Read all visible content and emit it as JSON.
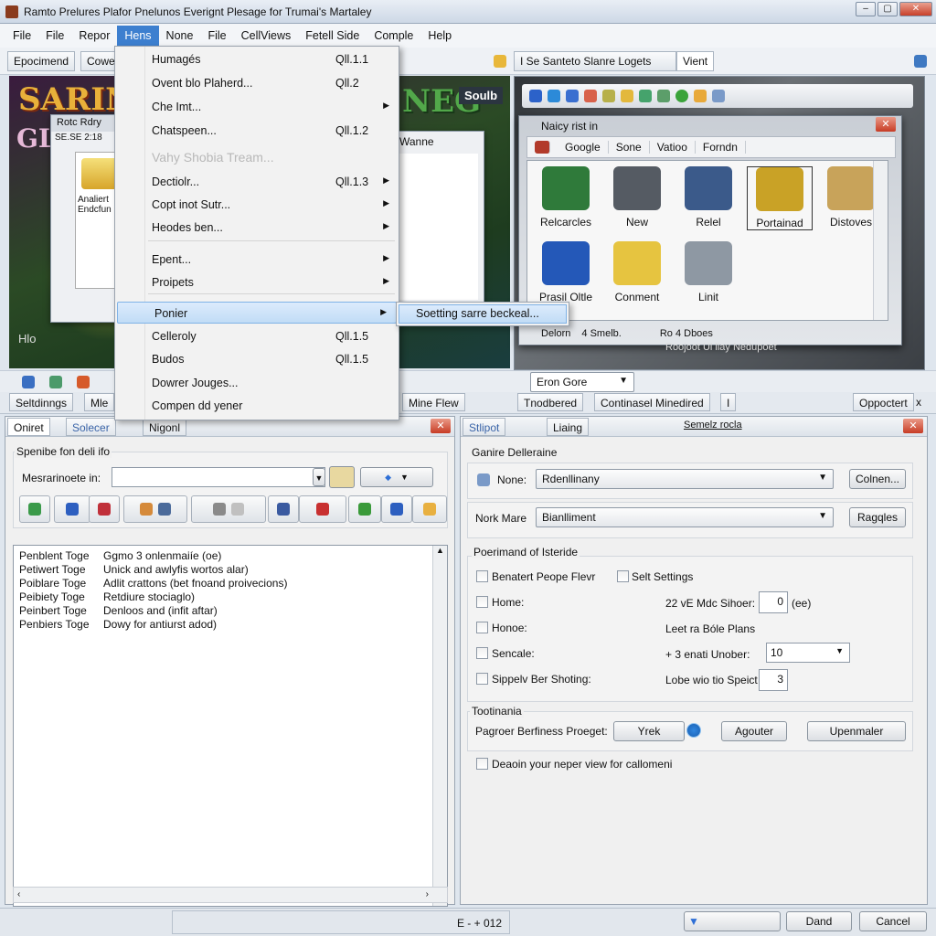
{
  "window": {
    "title": "Ramto Prelures Plafor Pnelunos Everignt Plesage for Trumai's Martaley",
    "controls": [
      "–",
      "▢",
      "✕"
    ]
  },
  "menubar": [
    "File",
    "File",
    "Repor",
    "Hens",
    "None",
    "File",
    "CellViews",
    "Fetell Side",
    "Comple",
    "Help"
  ],
  "menubar_active": 3,
  "toolbar": {
    "tab1": "Epocimend",
    "tab2": "Cowe",
    "right_tab": "I Se Santeto Slanre Logets",
    "right_tab2": "Vient"
  },
  "game": {
    "title": "SARINX",
    "title2": "GLI",
    "logo": "NEG",
    "badge": "Soulb",
    "inner_window_title": "Rotc Rdry",
    "inner_toolbar": "SE.SE 2:18",
    "inner_text1": "Analiert",
    "inner_text2": "Endcfun",
    "side_window_title": "Wanne",
    "corner_text": "Hlo"
  },
  "dropdown_menu": {
    "items": [
      {
        "label": "Humagés",
        "shortcut": "Qll.1.1",
        "arrow": false
      },
      {
        "label": "Ovent blo Plaherd...",
        "shortcut": "Qll.2",
        "arrow": false
      },
      {
        "label": "Che Imt...",
        "shortcut": "",
        "arrow": true
      },
      {
        "label": "Chatspeen...",
        "shortcut": "Qll.1.2",
        "arrow": false
      },
      {
        "label": "Vahy Shobia Tream...",
        "shortcut": "",
        "arrow": false,
        "disabled": true
      },
      {
        "label": "Dectiolr...",
        "shortcut": "Qll.1.3",
        "arrow": true
      },
      {
        "label": "Copt inot Sutr...",
        "shortcut": "",
        "arrow": true
      },
      {
        "label": "Heodes ben...",
        "shortcut": "",
        "arrow": true
      },
      {
        "label": "Epent...",
        "shortcut": "",
        "arrow": true
      },
      {
        "label": "Proipets",
        "shortcut": "",
        "arrow": true
      },
      {
        "label": "Ponier",
        "shortcut": "",
        "arrow": true,
        "highlighted": true
      },
      {
        "label": "Celleroly",
        "shortcut": "Qll.1.5",
        "arrow": false
      },
      {
        "label": "Budos",
        "shortcut": "Qll.1.5",
        "arrow": false
      },
      {
        "label": "Dowrer Jouges...",
        "shortcut": "",
        "arrow": false
      },
      {
        "label": "Compen dd yener",
        "shortcut": "",
        "arrow": false
      }
    ],
    "submenu": "Soetting sarre beckeal..."
  },
  "right_dialog": {
    "title": "Naicy rist in",
    "tabs": [
      "Google",
      "Sone",
      "Vatioo",
      "Forndn"
    ],
    "tiles": [
      {
        "label": "Relcarcles",
        "color": "#2f7a3a"
      },
      {
        "label": "New",
        "color": "#555b63"
      },
      {
        "label": "Relel",
        "color": "#3b5a8a"
      },
      {
        "label": "Portainad",
        "color": "#c9a226",
        "selected": true
      },
      {
        "label": "Distoves",
        "color": "#c8a35a"
      },
      {
        "label": "Prasil Oltle",
        "color": "#2458b8"
      },
      {
        "label": "Conment",
        "color": "#e6c440"
      },
      {
        "label": "Linit",
        "color": "#8e98a3"
      }
    ],
    "status_left": "Delorn",
    "status_mid": "4 Smelb.",
    "status_right": "Ro 4 Dboes",
    "caption": "Roojoot Ul liay Nedupoet"
  },
  "row2": {
    "combo": "Eron Gore"
  },
  "row3": {
    "left_tabs": [
      "Seltdinngs",
      "Mle",
      "Mine Flew"
    ],
    "right_tabs": [
      "Tnodbered",
      "Continasel Minedired",
      "I"
    ],
    "right_button": "Oppoctert",
    "close": "x"
  },
  "left_panel": {
    "tabs": [
      "Oniret",
      "Solecer",
      "Nigonl"
    ],
    "group_label": "Spenibe fon deli ifo",
    "field_label": "Mesrarinoete in:",
    "field_value": "",
    "list": [
      [
        "Penblent Toge",
        "Ggmo 3 onlenmaiíe (oe)"
      ],
      [
        "Petiwert Toge",
        "Unick and awlyfis wortos alar)"
      ],
      [
        "Poiblare Toge",
        "Adlit crattons (bet fnoand proivecions)"
      ],
      [
        "Peibiety Toge",
        "Retdiure stociaglo)"
      ],
      [
        "Peinbert Toge",
        "Denloos and (infit aftar)"
      ],
      [
        "Penbiers Toge",
        "Dowy for antiurst adod)"
      ]
    ]
  },
  "right_panel": {
    "tabs": [
      "Stlipot",
      "Liaing"
    ],
    "title": "Semelz rocla",
    "group1": "Ganire Delleraine",
    "none_label": "None:",
    "none_value": "Rdenllinany",
    "none_btn": "Colnen...",
    "nork_label": "Nork Mare",
    "nork_value": "Bianlliment",
    "nork_btn": "Ragqles",
    "group2": "Poerimand of Isteride",
    "checks_left": [
      "Benatert Peope Flevr",
      "Home:",
      "Honoe:",
      "Sencale:",
      "Sippelv Ber Shoting:"
    ],
    "check_mid": "Selt Settings",
    "field1_label": "22 vE Mdc Sihoer:",
    "field1_value": "0",
    "field1_unit": "(ee)",
    "text_mid": "Leet ra Bóle Plans",
    "field2_label": "+ 3 enati Unober:",
    "field2_value": "10",
    "field3_label": "Lobe wio tio Speict",
    "field3_value": "3",
    "group3": "Tootinania",
    "prop_label": "Pagroer Berfiness Proeget:",
    "btn1": "Yrek",
    "btn2": "Agouter",
    "btn3": "Upenmaler",
    "bottom_check": "Deaoin your neper view for callomeni"
  },
  "status": {
    "text": "E - + 012",
    "ok": "Dand",
    "cancel": "Cancel"
  }
}
